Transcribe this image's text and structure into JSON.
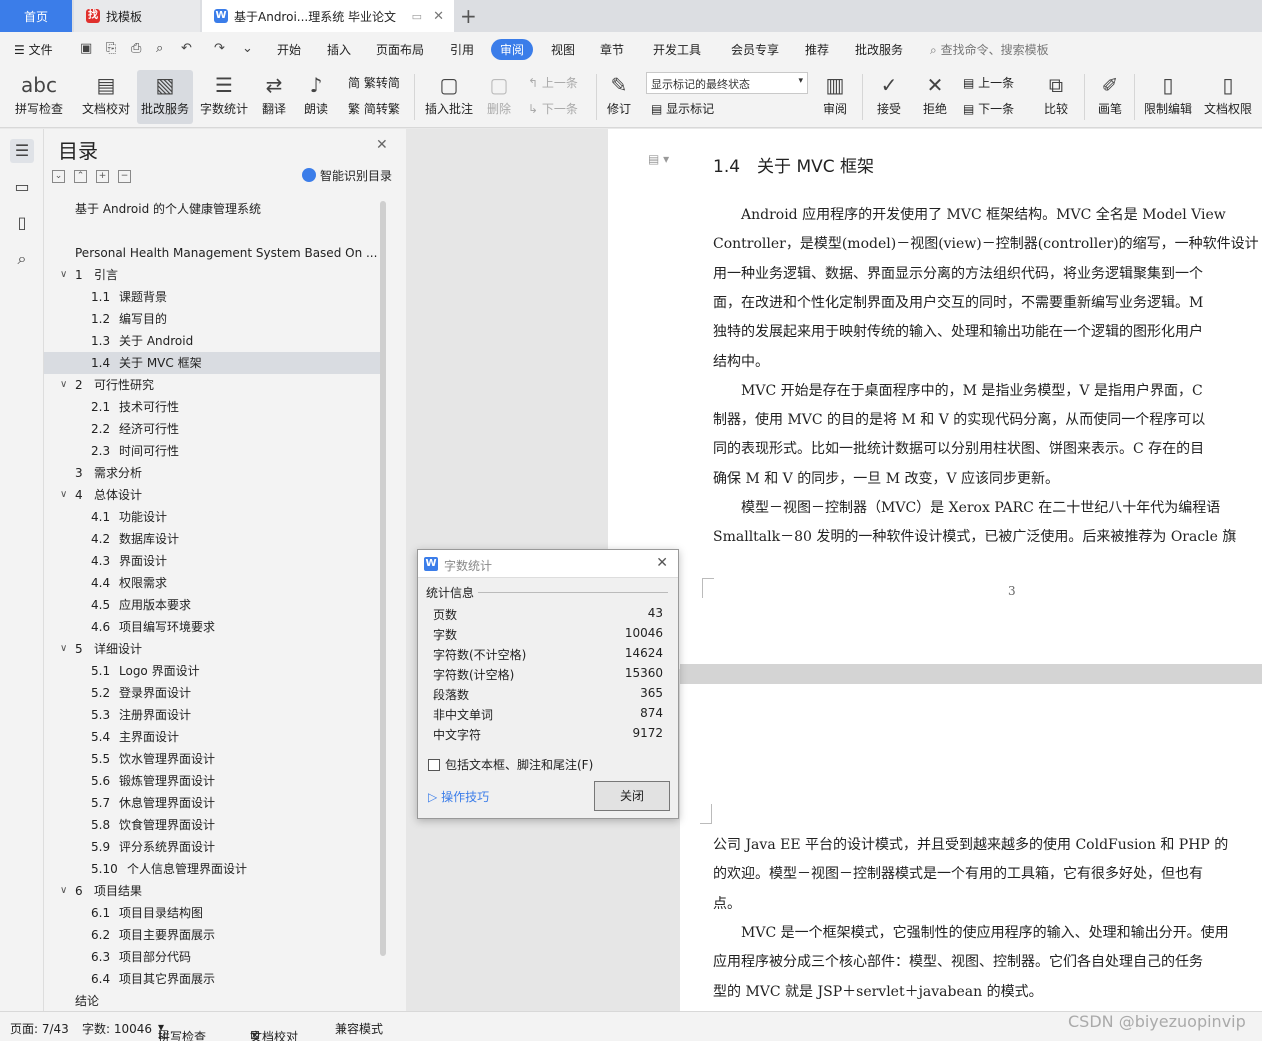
{
  "tabs": {
    "home": "首页",
    "template": "找模板",
    "doc": "基于Androi...理系统 毕业论文"
  },
  "menu": {
    "file": "文件",
    "items": [
      "开始",
      "插入",
      "页面布局",
      "引用",
      "审阅",
      "视图",
      "章节",
      "开发工具",
      "会员专享",
      "推荐",
      "批改服务"
    ],
    "active": "审阅",
    "search": "查找命令、搜索模板"
  },
  "ribbon": {
    "spell": "拼写检查",
    "proof": "文档校对",
    "review_service": "批改服务",
    "word_count": "字数统计",
    "translate": "翻译",
    "read": "朗读",
    "trad": "繁转简",
    "simp": "简转繁",
    "insert_comment": "插入批注",
    "delete": "删除",
    "prev": "上一条",
    "next": "下一条",
    "revise": "修订",
    "markup_state": "显示标记的最终状态",
    "show_markup": "显示标记",
    "review": "审阅",
    "accept": "接受",
    "reject": "拒绝",
    "prev2": "上一条",
    "next2": "下一条",
    "compare": "比较",
    "pen": "画笔",
    "restrict": "限制编辑",
    "rights": "文档权限"
  },
  "toc": {
    "title": "目录",
    "ai": "智能识别目录",
    "items": [
      {
        "num": "",
        "label": "基于 Android 的个人健康管理系统",
        "level": 0,
        "arrow": false
      },
      {
        "num": "",
        "label": "",
        "level": 0,
        "arrow": false
      },
      {
        "num": "",
        "label": "Personal Health Management System Based On ...",
        "level": 0,
        "arrow": false
      },
      {
        "num": "1",
        "label": "引言",
        "level": 1,
        "arrow": true
      },
      {
        "num": "1.1",
        "label": "课题背景",
        "level": 2,
        "arrow": false
      },
      {
        "num": "1.2",
        "label": "编写目的",
        "level": 2,
        "arrow": false
      },
      {
        "num": "1.3",
        "label": "关于 Android",
        "level": 2,
        "arrow": false
      },
      {
        "num": "1.4",
        "label": "关于 MVC 框架",
        "level": 2,
        "arrow": false,
        "selected": true
      },
      {
        "num": "2",
        "label": "可行性研究",
        "level": 1,
        "arrow": true
      },
      {
        "num": "2.1",
        "label": "技术可行性",
        "level": 2,
        "arrow": false
      },
      {
        "num": "2.2",
        "label": "经济可行性",
        "level": 2,
        "arrow": false
      },
      {
        "num": "2.3",
        "label": "时间可行性",
        "level": 2,
        "arrow": false
      },
      {
        "num": "3",
        "label": "需求分析",
        "level": 1,
        "arrow": false
      },
      {
        "num": "4",
        "label": "总体设计",
        "level": 1,
        "arrow": true
      },
      {
        "num": "4.1",
        "label": "功能设计",
        "level": 2,
        "arrow": false
      },
      {
        "num": "4.2",
        "label": "数据库设计",
        "level": 2,
        "arrow": false
      },
      {
        "num": "4.3",
        "label": "界面设计",
        "level": 2,
        "arrow": false
      },
      {
        "num": "4.4",
        "label": "权限需求",
        "level": 2,
        "arrow": false
      },
      {
        "num": "4.5",
        "label": "应用版本要求",
        "level": 2,
        "arrow": false
      },
      {
        "num": "4.6",
        "label": "项目编写环境要求",
        "level": 2,
        "arrow": false
      },
      {
        "num": "5",
        "label": "详细设计",
        "level": 1,
        "arrow": true
      },
      {
        "num": "5.1",
        "label": "Logo 界面设计",
        "level": 2,
        "arrow": false
      },
      {
        "num": "5.2",
        "label": "登录界面设计",
        "level": 2,
        "arrow": false
      },
      {
        "num": "5.3",
        "label": "注册界面设计",
        "level": 2,
        "arrow": false
      },
      {
        "num": "5.4",
        "label": "主界面设计",
        "level": 2,
        "arrow": false
      },
      {
        "num": "5.5",
        "label": "饮水管理界面设计",
        "level": 2,
        "arrow": false
      },
      {
        "num": "5.6",
        "label": "锻炼管理界面设计",
        "level": 2,
        "arrow": false
      },
      {
        "num": "5.7",
        "label": "休息管理界面设计",
        "level": 2,
        "arrow": false
      },
      {
        "num": "5.8",
        "label": "饮食管理界面设计",
        "level": 2,
        "arrow": false
      },
      {
        "num": "5.9",
        "label": "评分系统界面设计",
        "level": 2,
        "arrow": false
      },
      {
        "num": "5.10",
        "label": "个人信息管理界面设计",
        "level": 2,
        "arrow": false
      },
      {
        "num": "6",
        "label": "项目结果",
        "level": 1,
        "arrow": true
      },
      {
        "num": "6.1",
        "label": "项目目录结构图",
        "level": 2,
        "arrow": false
      },
      {
        "num": "6.2",
        "label": "项目主要界面展示",
        "level": 2,
        "arrow": false
      },
      {
        "num": "6.3",
        "label": "项目部分代码",
        "level": 2,
        "arrow": false
      },
      {
        "num": "6.4",
        "label": "项目其它界面展示",
        "level": 2,
        "arrow": false
      },
      {
        "num": "",
        "label": "结论",
        "level": 0,
        "arrow": false
      }
    ]
  },
  "doc": {
    "heading": "1.4　关于 MVC 框架",
    "page1_lines": [
      "　　Android 应用程序的开发使用了 MVC 框架结构。MVC 全名是 Model View",
      "Controller，是模型(model)－视图(view)－控制器(controller)的缩写，一种软件设计",
      "用一种业务逻辑、数据、界面显示分离的方法组织代码，将业务逻辑聚集到一个",
      "面，在改进和个性化定制界面及用户交互的同时，不需要重新编写业务逻辑。M",
      "独特的发展起来用于映射传统的输入、处理和输出功能在一个逻辑的图形化用户",
      "结构中。",
      "　　MVC 开始是存在于桌面程序中的，M 是指业务模型，V 是指用户界面，C",
      "制器，使用 MVC 的目的是将 M 和 V 的实现代码分离，从而使同一个程序可以",
      "同的表现形式。比如一批统计数据可以分别用柱状图、饼图来表示。C 存在的目",
      "确保 M 和 V 的同步，一旦 M 改变，V 应该同步更新。",
      "　　模型－视图－控制器（MVC）是 Xerox PARC 在二十世纪八十年代为编程语",
      "Smalltalk－80 发明的一种软件设计模式，已被广泛使用。后来被推荐为 Oracle 旗"
    ],
    "page_number": "3",
    "page2_lines": [
      "公司 Java EE 平台的设计模式，并且受到越来越多的使用 ColdFusion 和 PHP 的",
      "的欢迎。模型－视图－控制器模式是一个有用的工具箱，它有很多好处，但也有",
      "点。",
      "　　MVC 是一个框架模式，它强制性的使应用程序的输入、处理和输出分开。使用",
      "应用程序被分成三个核心部件：模型、视图、控制器。它们各自处理自己的任务",
      "型的 MVC 就是 JSP＋servlet＋javabean 的模式。"
    ]
  },
  "dialog": {
    "title": "字数统计",
    "section": "统计信息",
    "rows": [
      {
        "label": "页数",
        "value": "43"
      },
      {
        "label": "字数",
        "value": "10046"
      },
      {
        "label": "字符数(不计空格)",
        "value": "14624"
      },
      {
        "label": "字符数(计空格)",
        "value": "15360"
      },
      {
        "label": "段落数",
        "value": "365"
      },
      {
        "label": "非中文单词",
        "value": "874"
      },
      {
        "label": "中文字符",
        "value": "9172"
      }
    ],
    "checkbox": "包括文本框、脚注和尾注(F)",
    "tips": "操作技巧",
    "close": "关闭"
  },
  "status": {
    "page": "页面: 7/43",
    "words": "字数: 10046",
    "spell": "拼写检查",
    "proof": "文档校对",
    "compat": "兼容模式"
  },
  "watermark": "CSDN @biyezuopinvip"
}
